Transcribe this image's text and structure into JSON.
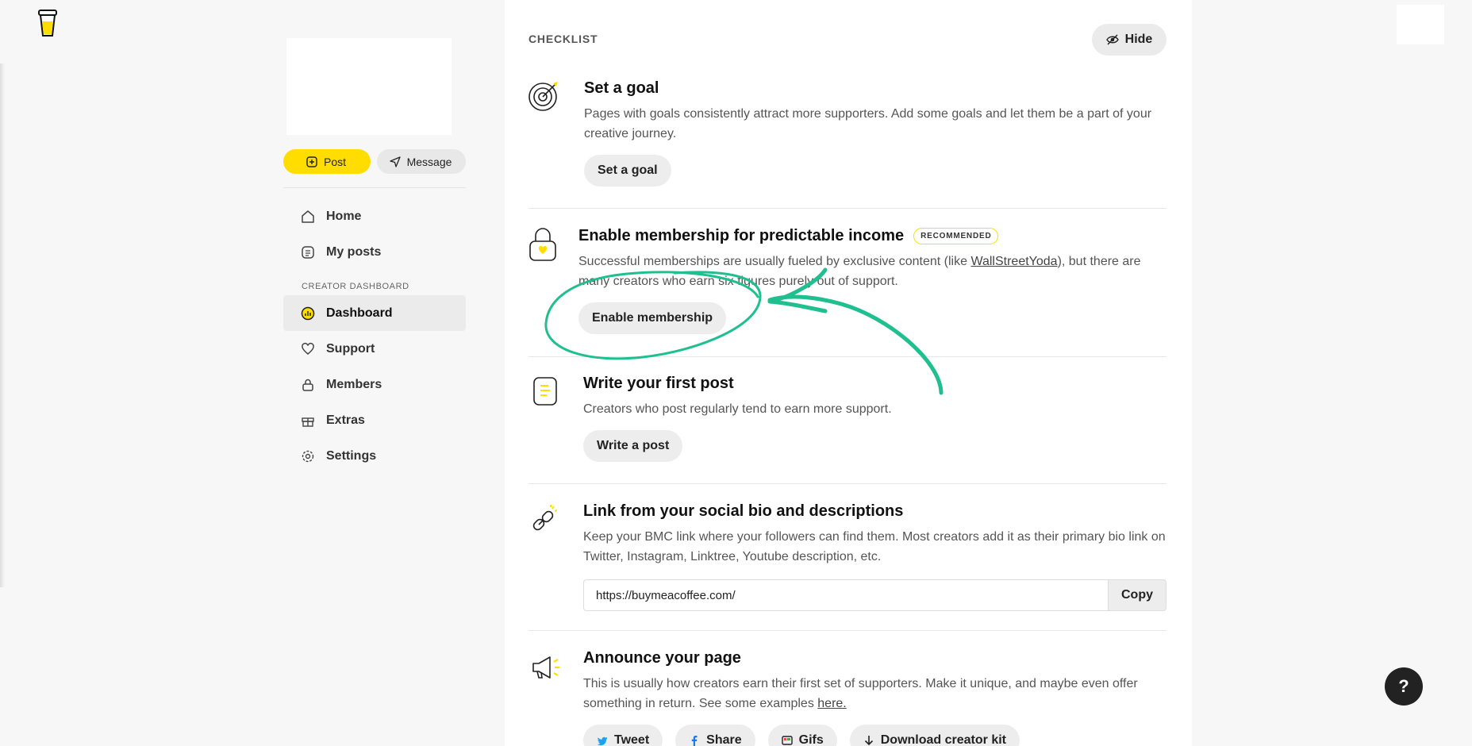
{
  "sidebar": {
    "post_label": "Post",
    "message_label": "Message",
    "items_top": [
      {
        "label": "Home"
      },
      {
        "label": "My posts"
      }
    ],
    "section_label": "CREATOR DASHBOARD",
    "items_bottom": [
      {
        "label": "Dashboard",
        "active": true
      },
      {
        "label": "Support"
      },
      {
        "label": "Members"
      },
      {
        "label": "Extras"
      },
      {
        "label": "Settings"
      }
    ]
  },
  "checklist": {
    "title": "CHECKLIST",
    "hide_label": "Hide",
    "items": [
      {
        "title": "Set a goal",
        "desc": "Pages with goals consistently attract more supporters. Add some goals and let them be a part of your creative journey.",
        "button": "Set a goal"
      },
      {
        "title": "Enable membership for predictable income",
        "badge": "RECOMMENDED",
        "desc_before": "Successful memberships are usually fueled by exclusive content (like ",
        "desc_link": "WallStreetYoda",
        "desc_after": "), but there are many creators who earn six figures purely out of support.",
        "button": "Enable membership"
      },
      {
        "title": "Write your first post",
        "desc": "Creators who post regularly tend to earn more support.",
        "button": "Write a post"
      },
      {
        "title": "Link from your social bio and descriptions",
        "desc": "Keep your BMC link where your followers can find them. Most creators add it as their primary bio link on Twitter, Instagram, Linktree, Youtube description, etc.",
        "link_value": "https://buymeacoffee.com/",
        "copy_label": "Copy"
      },
      {
        "title": "Announce your page",
        "desc_before": "This is usually how creators earn their first set of supporters. Make it unique, and maybe even offer something in return. See some examples ",
        "desc_link": "here.",
        "buttons": [
          "Tweet",
          "Share",
          "Gifs",
          "Download creator kit"
        ]
      }
    ]
  },
  "help_label": "?",
  "colors": {
    "accent": "#ffdd00",
    "annotation": "#1fbf8f"
  }
}
